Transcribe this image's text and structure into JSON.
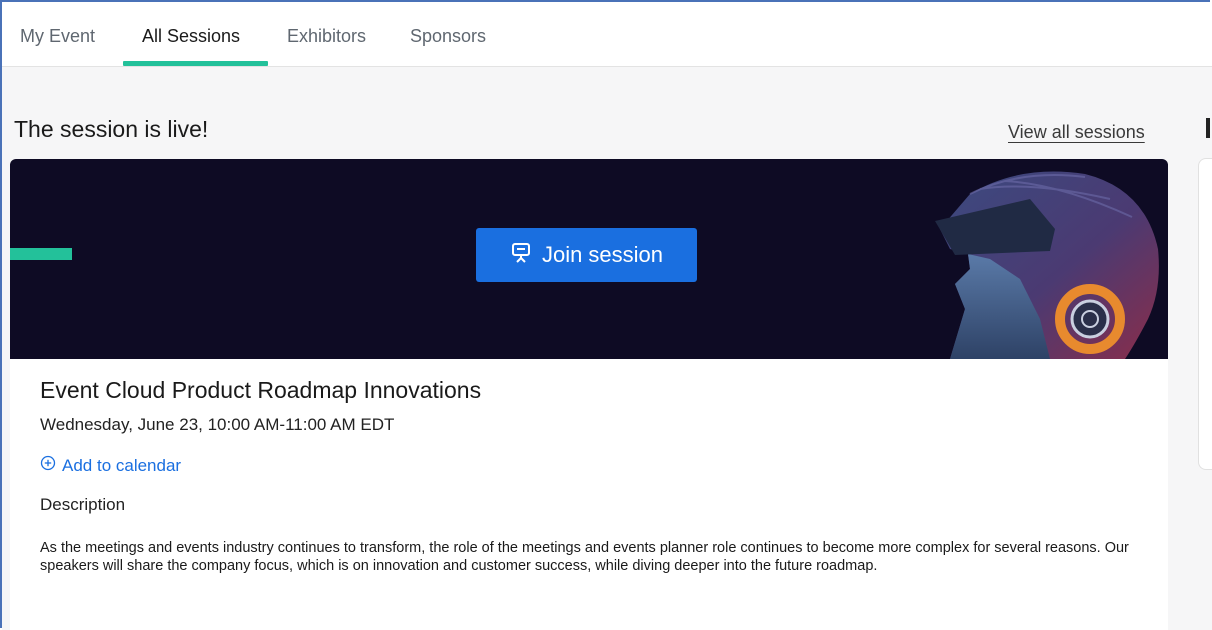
{
  "tabs": [
    {
      "label": "My Event"
    },
    {
      "label": "All Sessions"
    },
    {
      "label": "Exhibitors"
    },
    {
      "label": "Sponsors"
    }
  ],
  "active_tab": "All Sessions",
  "headline": "The session is live!",
  "view_all_link": "View all sessions",
  "session": {
    "join_button": "Join session",
    "title": "Event Cloud Product Roadmap Innovations",
    "datetime": "Wednesday, June 23, 10:00 AM-11:00 AM EDT",
    "add_to_calendar": "Add to calendar",
    "description_label": "Description",
    "description": "As the meetings and events industry continues to transform, the role of the meetings and events planner role continues to become more complex for several reasons. Our speakers will share the company focus, which is on innovation and customer success, while diving deeper into the future roadmap."
  },
  "colors": {
    "accent_green": "#23c19a",
    "primary_blue": "#1a6fe0",
    "banner_bg": "#0e0b24"
  },
  "icons": {
    "join": "presentation-screen-icon",
    "calendar": "plus-circle-icon"
  }
}
